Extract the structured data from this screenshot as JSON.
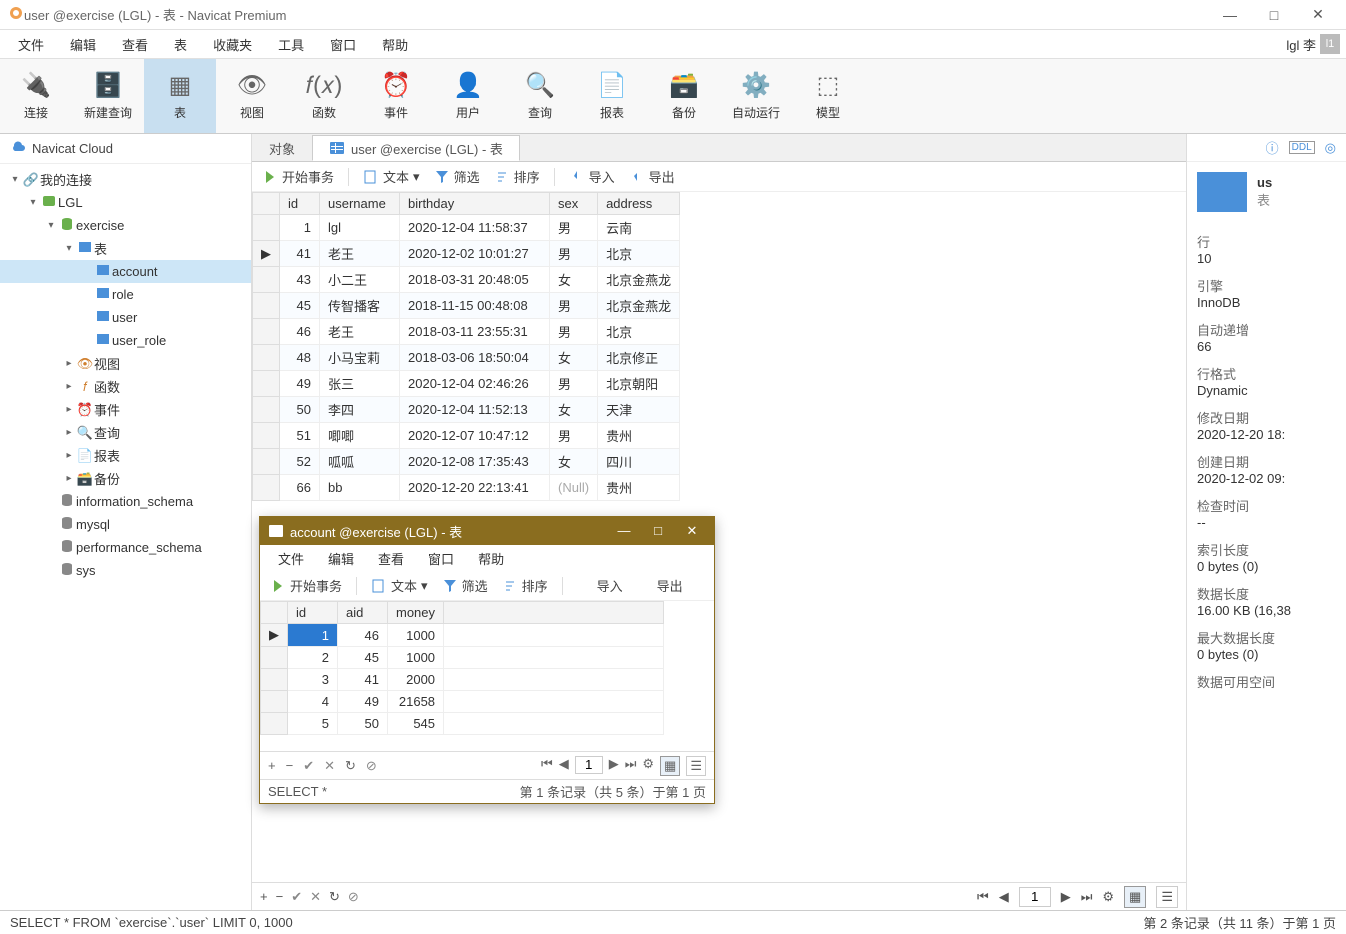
{
  "window": {
    "title": "user @exercise (LGL) - 表 - Navicat Premium"
  },
  "menu": {
    "items": [
      "文件",
      "编辑",
      "查看",
      "表",
      "收藏夹",
      "工具",
      "窗口",
      "帮助"
    ],
    "user_label": "lgl 李",
    "user_badge": "l1"
  },
  "ribbon": [
    {
      "label": "连接"
    },
    {
      "label": "新建查询"
    },
    {
      "label": "表"
    },
    {
      "label": "视图"
    },
    {
      "label": "函数"
    },
    {
      "label": "事件"
    },
    {
      "label": "用户"
    },
    {
      "label": "查询"
    },
    {
      "label": "报表"
    },
    {
      "label": "备份"
    },
    {
      "label": "自动运行"
    },
    {
      "label": "模型"
    }
  ],
  "cloud_label": "Navicat Cloud",
  "tree": {
    "root": "我的连接",
    "conn": "LGL",
    "db": "exercise",
    "tables_label": "表",
    "tables": [
      "account",
      "role",
      "user",
      "user_role"
    ],
    "other_nodes": [
      "视图",
      "函数",
      "事件",
      "查询",
      "报表",
      "备份"
    ],
    "other_dbs": [
      "information_schema",
      "mysql",
      "performance_schema",
      "sys"
    ]
  },
  "tabs": {
    "obj": "对象",
    "active": "user @exercise (LGL) - 表"
  },
  "table_toolbar": {
    "begin_tx": "开始事务",
    "text": "文本",
    "filter": "筛选",
    "sort": "排序",
    "import": "导入",
    "export": "导出"
  },
  "user_table": {
    "columns": [
      "id",
      "username",
      "birthday",
      "sex",
      "address"
    ],
    "rows": [
      {
        "id": 1,
        "username": "lgl",
        "birthday": "2020-12-04 11:58:37",
        "sex": "男",
        "address": "云南"
      },
      {
        "id": 41,
        "username": "老王",
        "birthday": "2020-12-02 10:01:27",
        "sex": "男",
        "address": "北京"
      },
      {
        "id": 43,
        "username": "小二王",
        "birthday": "2018-03-31 20:48:05",
        "sex": "女",
        "address": "北京金燕龙"
      },
      {
        "id": 45,
        "username": "传智播客",
        "birthday": "2018-11-15 00:48:08",
        "sex": "男",
        "address": "北京金燕龙"
      },
      {
        "id": 46,
        "username": "老王",
        "birthday": "2018-03-11 23:55:31",
        "sex": "男",
        "address": "北京"
      },
      {
        "id": 48,
        "username": "小马宝莉",
        "birthday": "2018-03-06 18:50:04",
        "sex": "女",
        "address": "北京修正"
      },
      {
        "id": 49,
        "username": "张三",
        "birthday": "2020-12-04 02:46:26",
        "sex": "男",
        "address": "北京朝阳"
      },
      {
        "id": 50,
        "username": "李四",
        "birthday": "2020-12-04 11:52:13",
        "sex": "女",
        "address": "天津"
      },
      {
        "id": 51,
        "username": "唧唧",
        "birthday": "2020-12-07 10:47:12",
        "sex": "男",
        "address": "贵州"
      },
      {
        "id": 52,
        "username": "呱呱",
        "birthday": "2020-12-08 17:35:43",
        "sex": "女",
        "address": "四川"
      },
      {
        "id": 66,
        "username": "bb",
        "birthday": "2020-12-20 22:13:41",
        "sex": "(Null)",
        "address": "贵州"
      }
    ]
  },
  "grid_footer": {
    "sql": "SELECT * FROM `exercise`.`user` LIMIT 0, 1000",
    "page": "1",
    "status": "第 2 条记录（共 11 条）于第 1 页"
  },
  "info_panel": {
    "name_short": "us",
    "type": "表",
    "props": [
      {
        "l": "行",
        "v": "10"
      },
      {
        "l": "引擎",
        "v": "InnoDB"
      },
      {
        "l": "自动递增",
        "v": "66"
      },
      {
        "l": "行格式",
        "v": "Dynamic"
      },
      {
        "l": "修改日期",
        "v": "2020-12-20 18:"
      },
      {
        "l": "创建日期",
        "v": "2020-12-02 09:"
      },
      {
        "l": "检查时间",
        "v": "--"
      },
      {
        "l": "索引长度",
        "v": "0 bytes (0)"
      },
      {
        "l": "数据长度",
        "v": "16.00 KB (16,38"
      },
      {
        "l": "最大数据长度",
        "v": "0 bytes (0)"
      },
      {
        "l": "数据可用空间",
        "v": ""
      }
    ]
  },
  "popup": {
    "title": "account @exercise (LGL) - 表",
    "menu": [
      "文件",
      "编辑",
      "查看",
      "窗口",
      "帮助"
    ],
    "columns": [
      "id",
      "aid",
      "money"
    ],
    "rows": [
      {
        "id": 1,
        "aid": 46,
        "money": 1000
      },
      {
        "id": 2,
        "aid": 45,
        "money": 1000
      },
      {
        "id": 3,
        "aid": 41,
        "money": 2000
      },
      {
        "id": 4,
        "aid": 49,
        "money": 21658
      },
      {
        "id": 5,
        "aid": 50,
        "money": 545
      }
    ],
    "sql": "SELECT *",
    "status": "第 1 条记录（共 5 条）于第 1 页",
    "page": "1"
  }
}
